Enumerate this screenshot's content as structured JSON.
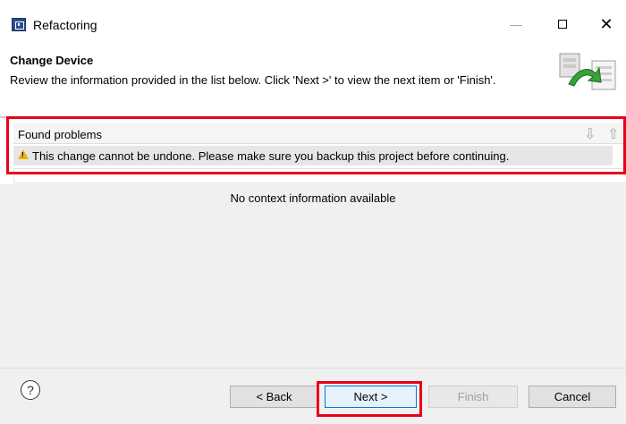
{
  "window": {
    "title": "Refactoring",
    "minimize": "—",
    "close": "✕"
  },
  "header": {
    "title": "Change Device",
    "description": "Review the information provided in the list below. Click 'Next >' to view the next item or 'Finish'."
  },
  "problems": {
    "label": "Found problems",
    "next_arrow": "⇩",
    "prev_arrow": "⇧",
    "items": [
      {
        "severity": "warning",
        "text": "This change cannot be undone. Please make sure you backup this project before continuing."
      }
    ]
  },
  "context": {
    "message": "No context information available"
  },
  "buttons": {
    "help": "?",
    "back": "< Back",
    "next": "Next >",
    "finish": "Finish",
    "cancel": "Cancel"
  },
  "colors": {
    "highlight": "#e8001a",
    "warning": "#f2b01e",
    "focus": "#0078d7"
  }
}
